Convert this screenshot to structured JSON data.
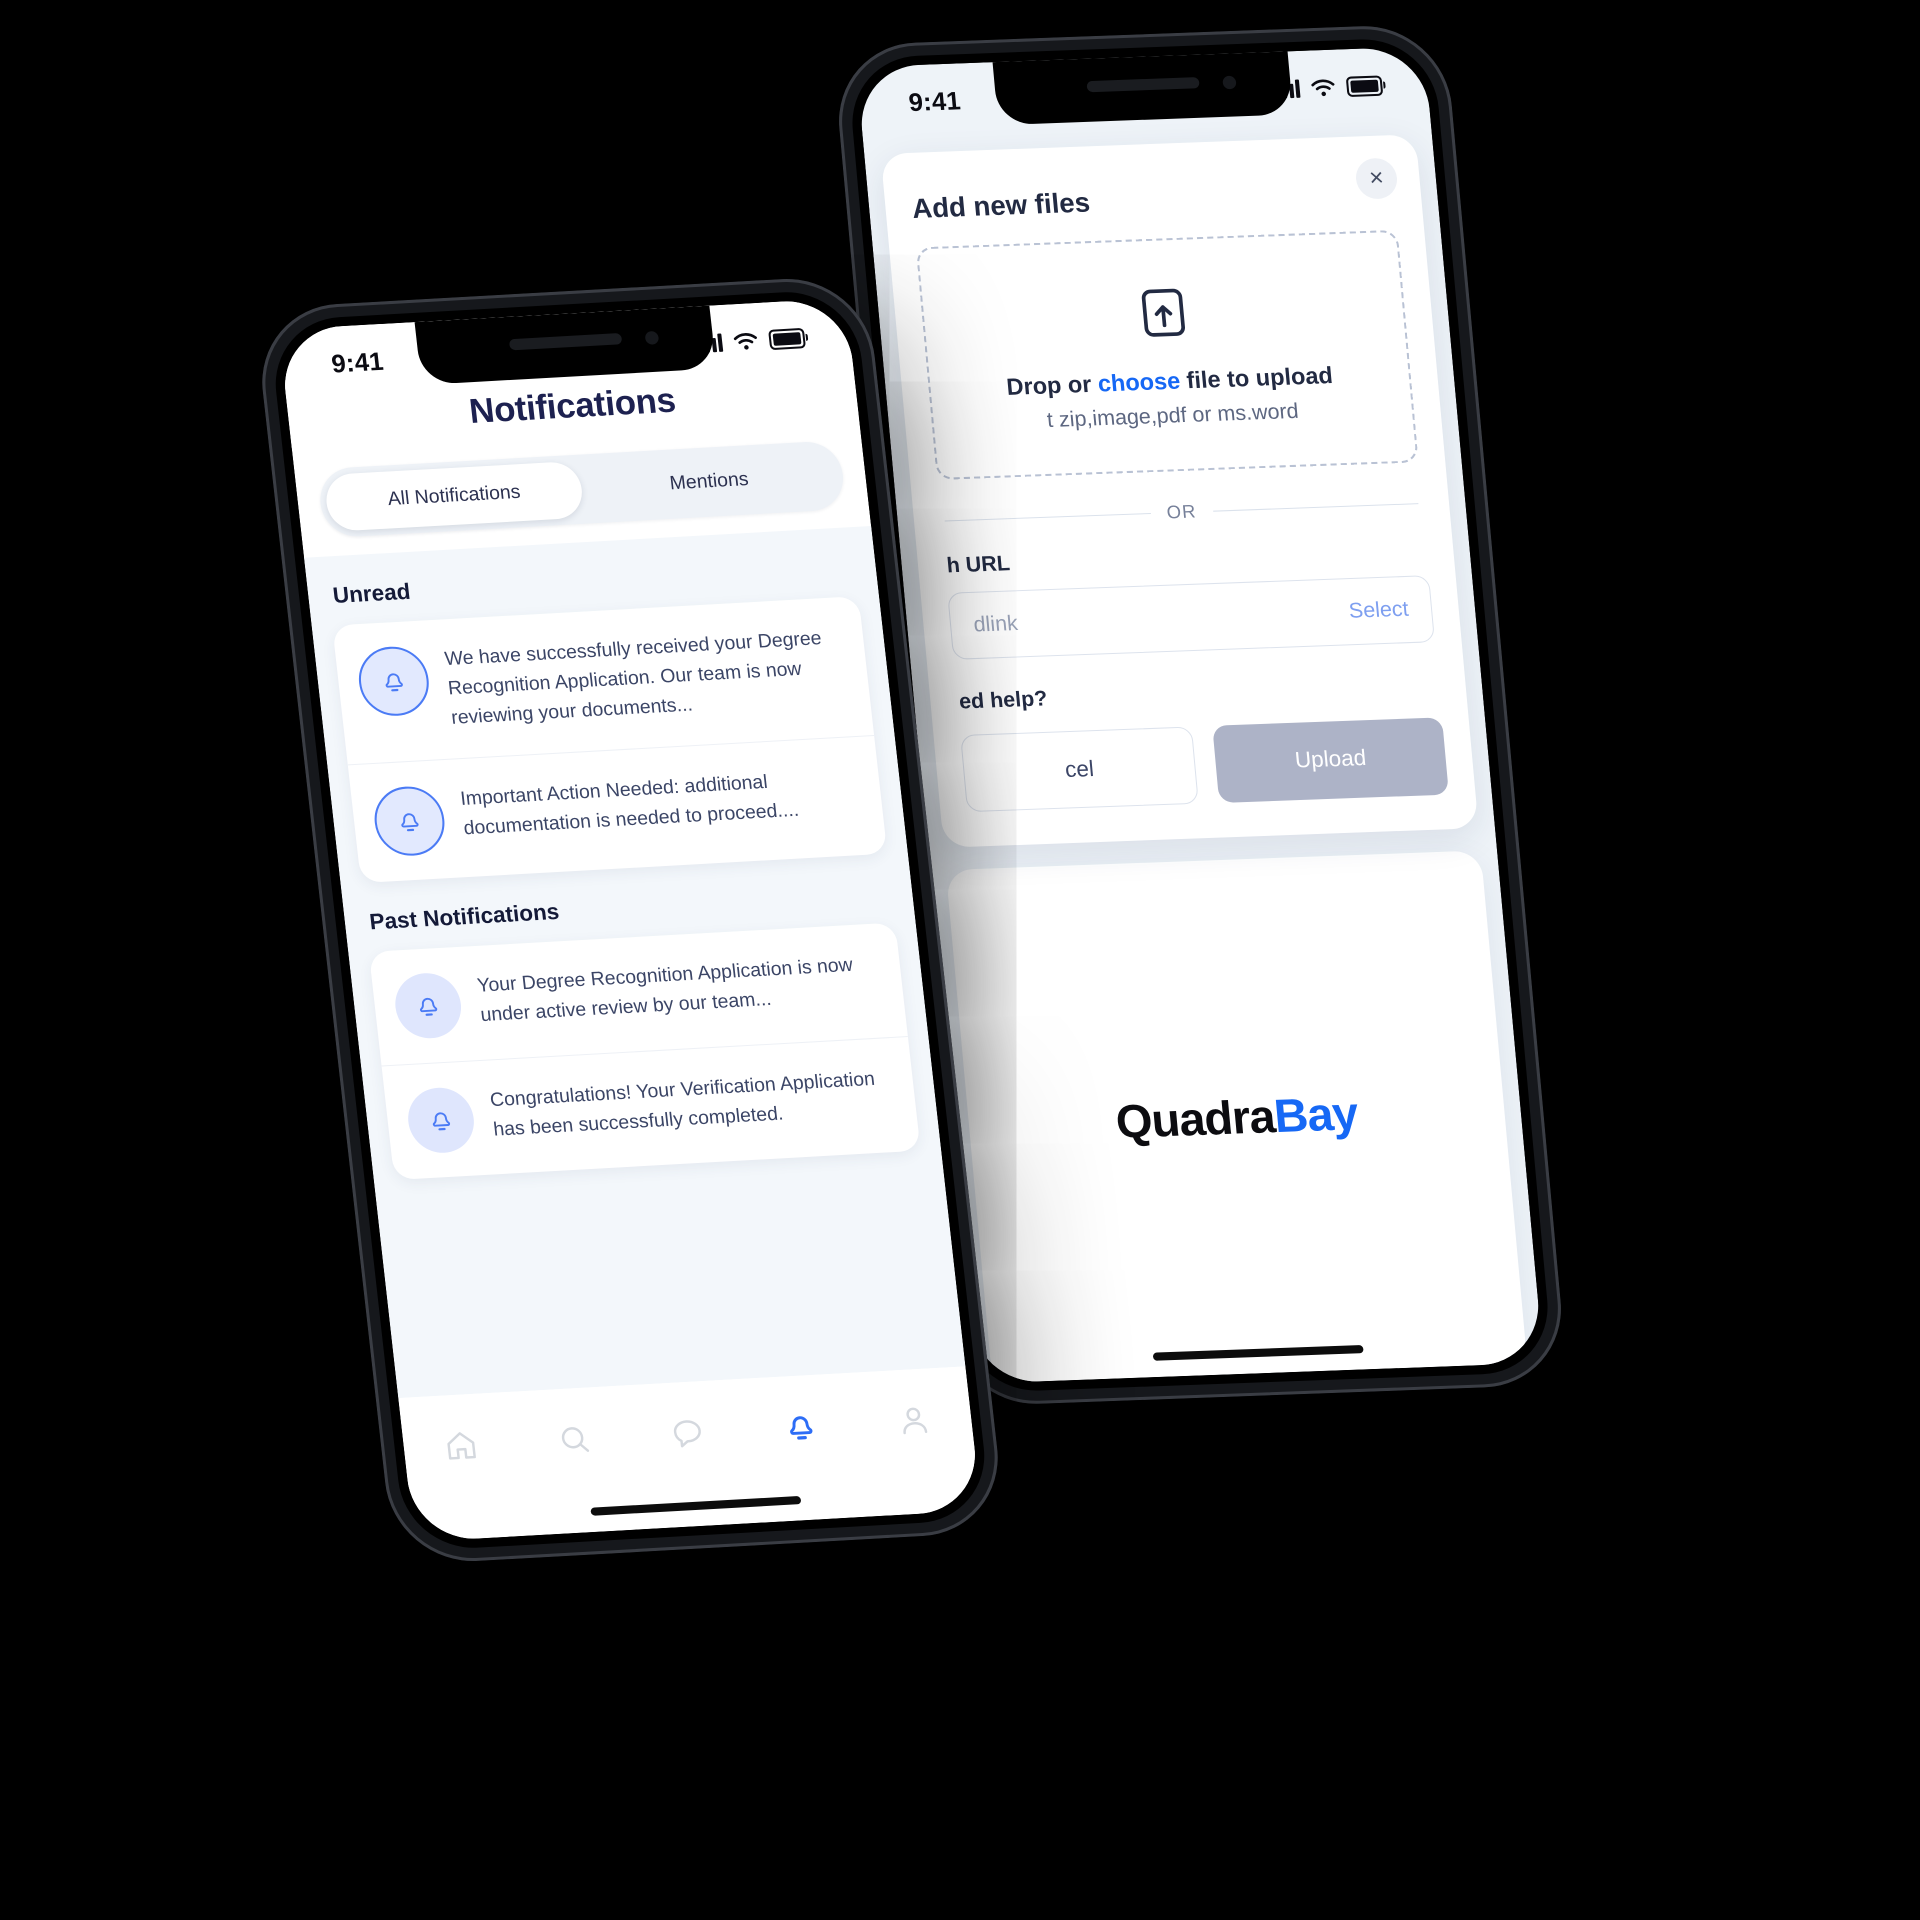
{
  "background_color": "#000000",
  "accent_color": "#1668f5",
  "front_phone": {
    "status_bar": {
      "time": "9:41",
      "signal_icon": "cellular-signal-icon",
      "wifi_icon": "wifi-icon",
      "battery_icon": "battery-icon"
    },
    "header": {
      "title": "Notifications"
    },
    "tabs": [
      {
        "label": "All Notifications",
        "active": true
      },
      {
        "label": "Mentions",
        "active": false
      }
    ],
    "sections": [
      {
        "title": "Unread",
        "items": [
          {
            "icon": "bell-icon",
            "text": "We have successfully received your Degree Recognition Application. Our team is now reviewing your documents..."
          },
          {
            "icon": "bell-icon",
            "text": "Important Action Needed: additional documentation is needed to proceed...."
          }
        ]
      },
      {
        "title": "Past Notifications",
        "items": [
          {
            "icon": "bell-icon",
            "text": "Your Degree Recognition Application is now under active review by our team..."
          },
          {
            "icon": "bell-icon",
            "text": "Congratulations! Your Verification Application has been successfully completed."
          }
        ]
      }
    ],
    "tabbar": [
      {
        "name": "home-icon",
        "active": false
      },
      {
        "name": "search-icon",
        "active": false
      },
      {
        "name": "chat-icon",
        "active": false
      },
      {
        "name": "bell-icon",
        "active": true
      },
      {
        "name": "profile-icon",
        "active": false
      }
    ]
  },
  "back_phone": {
    "status_bar": {
      "time": "9:41",
      "signal_icon": "cellular-signal-icon",
      "wifi_icon": "wifi-icon",
      "battery_icon": "battery-icon"
    },
    "modal": {
      "title": "Add new files",
      "close_label": "×",
      "dropzone": {
        "icon": "file-upload-icon",
        "text_before": "Drop or ",
        "link": "choose",
        "text_after": " file to upload",
        "hint": "t zip,image,pdf or ms.word"
      },
      "divider_label": "OR",
      "url_section": {
        "label": "h URL",
        "placeholder": "dlink",
        "action": "Select"
      },
      "help_label": "ed help?",
      "buttons": {
        "cancel": "cel",
        "upload": "Upload"
      }
    },
    "logo": {
      "part1": "Quadra",
      "part2": "Bay"
    }
  }
}
